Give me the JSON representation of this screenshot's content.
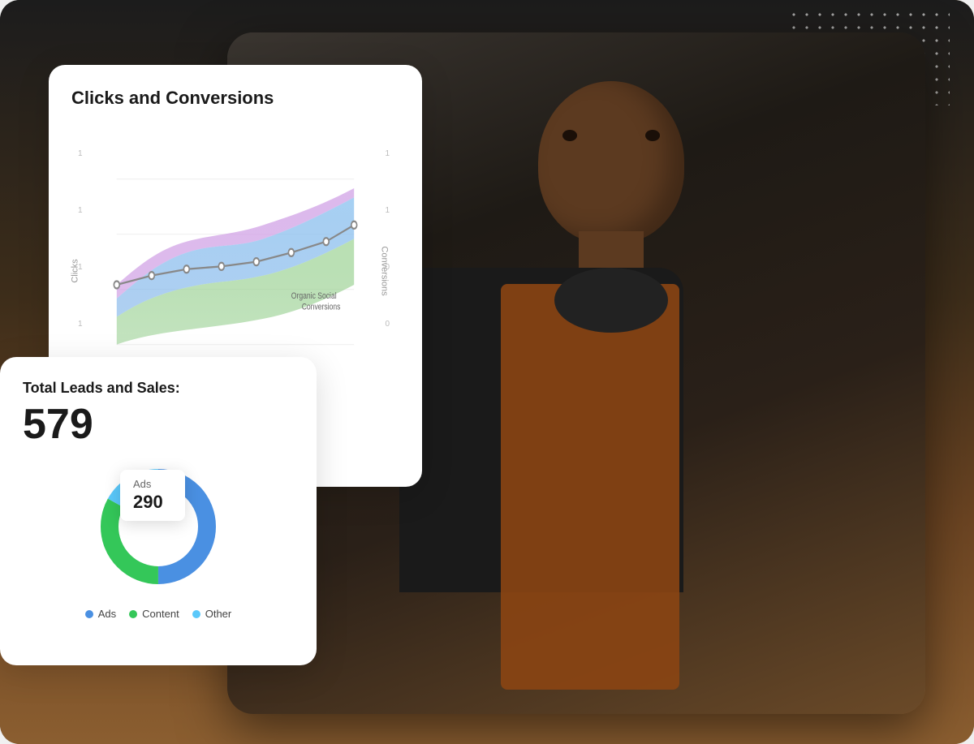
{
  "page": {
    "background": "#2c2c2c"
  },
  "clicks_card": {
    "title": "Clicks and Conversions",
    "y_axis_left": "Clicks",
    "y_axis_right": "Conversions",
    "tick_labels": [
      "1",
      "1",
      "1",
      "1",
      "0",
      "0"
    ],
    "chart": {
      "areas": [
        {
          "color": "#c5a0e0",
          "label": "purple-area"
        },
        {
          "color": "#a0c4f0",
          "label": "blue-area"
        },
        {
          "color": "#a8d8a0",
          "label": "green-area"
        }
      ]
    }
  },
  "leads_card": {
    "title": "Total Leads and Sales:",
    "total": "579",
    "tooltip": {
      "label": "Ads",
      "value": "290"
    },
    "donut": {
      "segments": [
        {
          "label": "Ads",
          "value": 290,
          "percentage": 50,
          "color": "#4A90E2"
        },
        {
          "label": "Content",
          "value": 195,
          "percentage": 33,
          "color": "#34C759"
        },
        {
          "label": "Other",
          "value": 94,
          "percentage": 17,
          "color": "#5AC8FA"
        }
      ]
    },
    "legend": [
      {
        "label": "Ads",
        "color": "#4A90E2"
      },
      {
        "label": "Content",
        "color": "#34C759"
      },
      {
        "label": "Other",
        "color": "#5AC8FA"
      }
    ]
  },
  "organic_label": "Organic Social",
  "conversions_label": "Conversions"
}
